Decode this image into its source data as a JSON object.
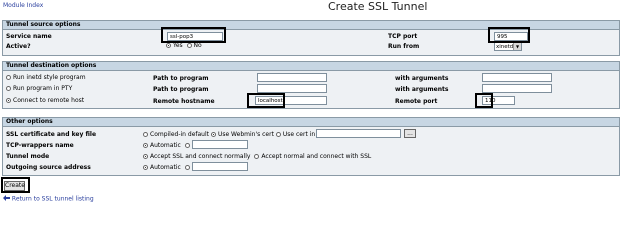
{
  "header": {
    "module_index": "Module Index",
    "title": "Create SSL Tunnel"
  },
  "source": {
    "heading": "Tunnel source options",
    "service_name_label": "Service name",
    "service_name_value": "ssl-pop3",
    "tcp_port_label": "TCP port",
    "tcp_port_value": "995",
    "active_label": "Active?",
    "active_yes": "Yes",
    "active_no": "No",
    "run_from_label": "Run from",
    "run_from_value": "xinetd"
  },
  "destination": {
    "heading": "Tunnel destination options",
    "opt1": "Run inetd style program",
    "opt2": "Run program in PTY",
    "opt3": "Connect to remote host",
    "path_label": "Path to program",
    "args_label": "with arguments",
    "remote_host_label": "Remote hostname",
    "remote_host_value": "localhost",
    "remote_port_label": "Remote port",
    "remote_port_value": "110"
  },
  "other": {
    "heading": "Other options",
    "cert_label": "SSL certificate and key file",
    "cert_opt1": "Compiled-in default",
    "cert_opt2": "Use Webmin's cert",
    "cert_opt3": "Use cert in file",
    "tcpw_label": "TCP-wrappers name",
    "auto": "Automatic",
    "mode_label": "Tunnel mode",
    "mode_opt1": "Accept SSL and connect normally",
    "mode_opt2": "Accept normal and connect with SSL",
    "outgoing_label": "Outgoing source address",
    "browse": "..."
  },
  "footer": {
    "create": "Create",
    "return_link": "Return to SSL tunnel listing"
  },
  "colors": {
    "section_header": "#c7d6e3",
    "section_body": "#eef1f4",
    "link": "#2a3f9e"
  }
}
